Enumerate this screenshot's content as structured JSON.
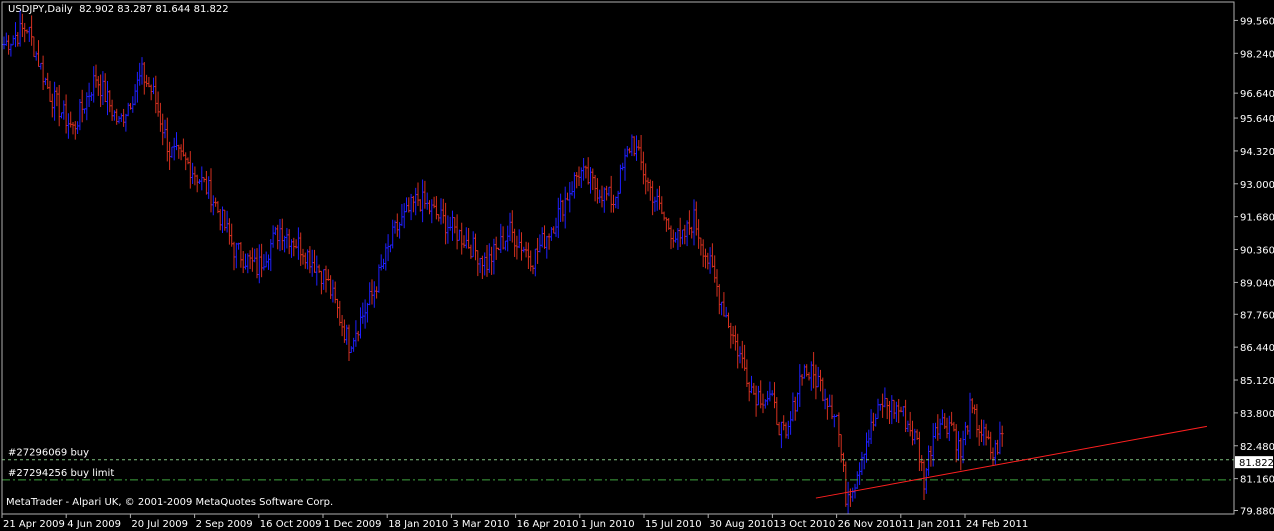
{
  "header": {
    "symbol": "USDJPY,Daily",
    "ohlc": "82.902 83.287 81.644 81.822"
  },
  "footer": {
    "text": "MetaTrader - Alpari UK, © 2001-2009 MetaQuotes Software Corp."
  },
  "orders": [
    {
      "label": "#27296069 buy",
      "price": 81.92,
      "color": "#7fbf7f"
    },
    {
      "label": "#27294256 buy limit",
      "price": 81.11,
      "color": "#3fa43f"
    }
  ],
  "current_price": {
    "label": "81.822",
    "value": 81.822
  },
  "colors": {
    "up": "#1f1fff",
    "down": "#d4301f",
    "trendline": "#ff2020",
    "axis": "#b0b0b0"
  },
  "chart_data": {
    "type": "bar",
    "ylim": [
      79.74,
      100.3
    ],
    "y_ticks": [
      "99.560",
      "98.240",
      "96.640",
      "95.640",
      "94.320",
      "93.000",
      "91.680",
      "90.360",
      "89.040",
      "87.760",
      "86.440",
      "85.120",
      "83.800",
      "82.480",
      "81.160",
      "79.880"
    ],
    "x_ticks": [
      "21 Apr 2009",
      "4 Jun 2009",
      "20 Jul 2009",
      "2 Sep 2009",
      "16 Oct 2009",
      "1 Dec 2009",
      "18 Jan 2010",
      "3 Mar 2010",
      "16 Apr 2010",
      "1 Jun 2010",
      "15 Jul 2010",
      "30 Aug 2010",
      "13 Oct 2010",
      "26 Nov 2010",
      "11 Jan 2011",
      "24 Feb 2011"
    ],
    "price_path": [
      [
        0,
        98.6
      ],
      [
        10,
        99.3
      ],
      [
        20,
        96.6
      ],
      [
        30,
        95.2
      ],
      [
        40,
        97.3
      ],
      [
        50,
        95.4
      ],
      [
        60,
        97.4
      ],
      [
        65,
        96.6
      ],
      [
        72,
        94.3
      ],
      [
        80,
        93.8
      ],
      [
        90,
        92.6
      ],
      [
        100,
        90.4
      ],
      [
        110,
        89.6
      ],
      [
        120,
        91.2
      ],
      [
        130,
        90.4
      ],
      [
        140,
        89.2
      ],
      [
        150,
        86.6
      ],
      [
        160,
        88.5
      ],
      [
        170,
        91.1
      ],
      [
        180,
        92.4
      ],
      [
        190,
        91.6
      ],
      [
        200,
        90.8
      ],
      [
        210,
        89.8
      ],
      [
        220,
        91.1
      ],
      [
        230,
        90.0
      ],
      [
        240,
        91.6
      ],
      [
        250,
        93.5
      ],
      [
        258,
        92.8
      ],
      [
        265,
        92.3
      ],
      [
        273,
        94.8
      ],
      [
        280,
        93.0
      ],
      [
        287,
        91.6
      ],
      [
        294,
        90.6
      ],
      [
        300,
        91.6
      ],
      [
        308,
        89.4
      ],
      [
        318,
        86.6
      ],
      [
        326,
        84.6
      ],
      [
        333,
        84.4
      ],
      [
        340,
        82.6
      ],
      [
        347,
        85.6
      ],
      [
        354,
        85.1
      ],
      [
        362,
        83.7
      ],
      [
        366,
        80.5
      ],
      [
        370,
        81.1
      ],
      [
        374,
        82.5
      ],
      [
        382,
        84.2
      ],
      [
        390,
        83.9
      ],
      [
        397,
        82.6
      ],
      [
        400,
        81.1
      ],
      [
        405,
        83.4
      ],
      [
        412,
        83.4
      ],
      [
        416,
        82.1
      ],
      [
        420,
        83.9
      ],
      [
        424,
        83.2
      ],
      [
        430,
        82.1
      ],
      [
        434,
        82.9
      ]
    ],
    "trendline": {
      "start": {
        "bar": 353,
        "price": 80.38
      },
      "end": {
        "bar": 523,
        "price": 83.26
      }
    }
  }
}
